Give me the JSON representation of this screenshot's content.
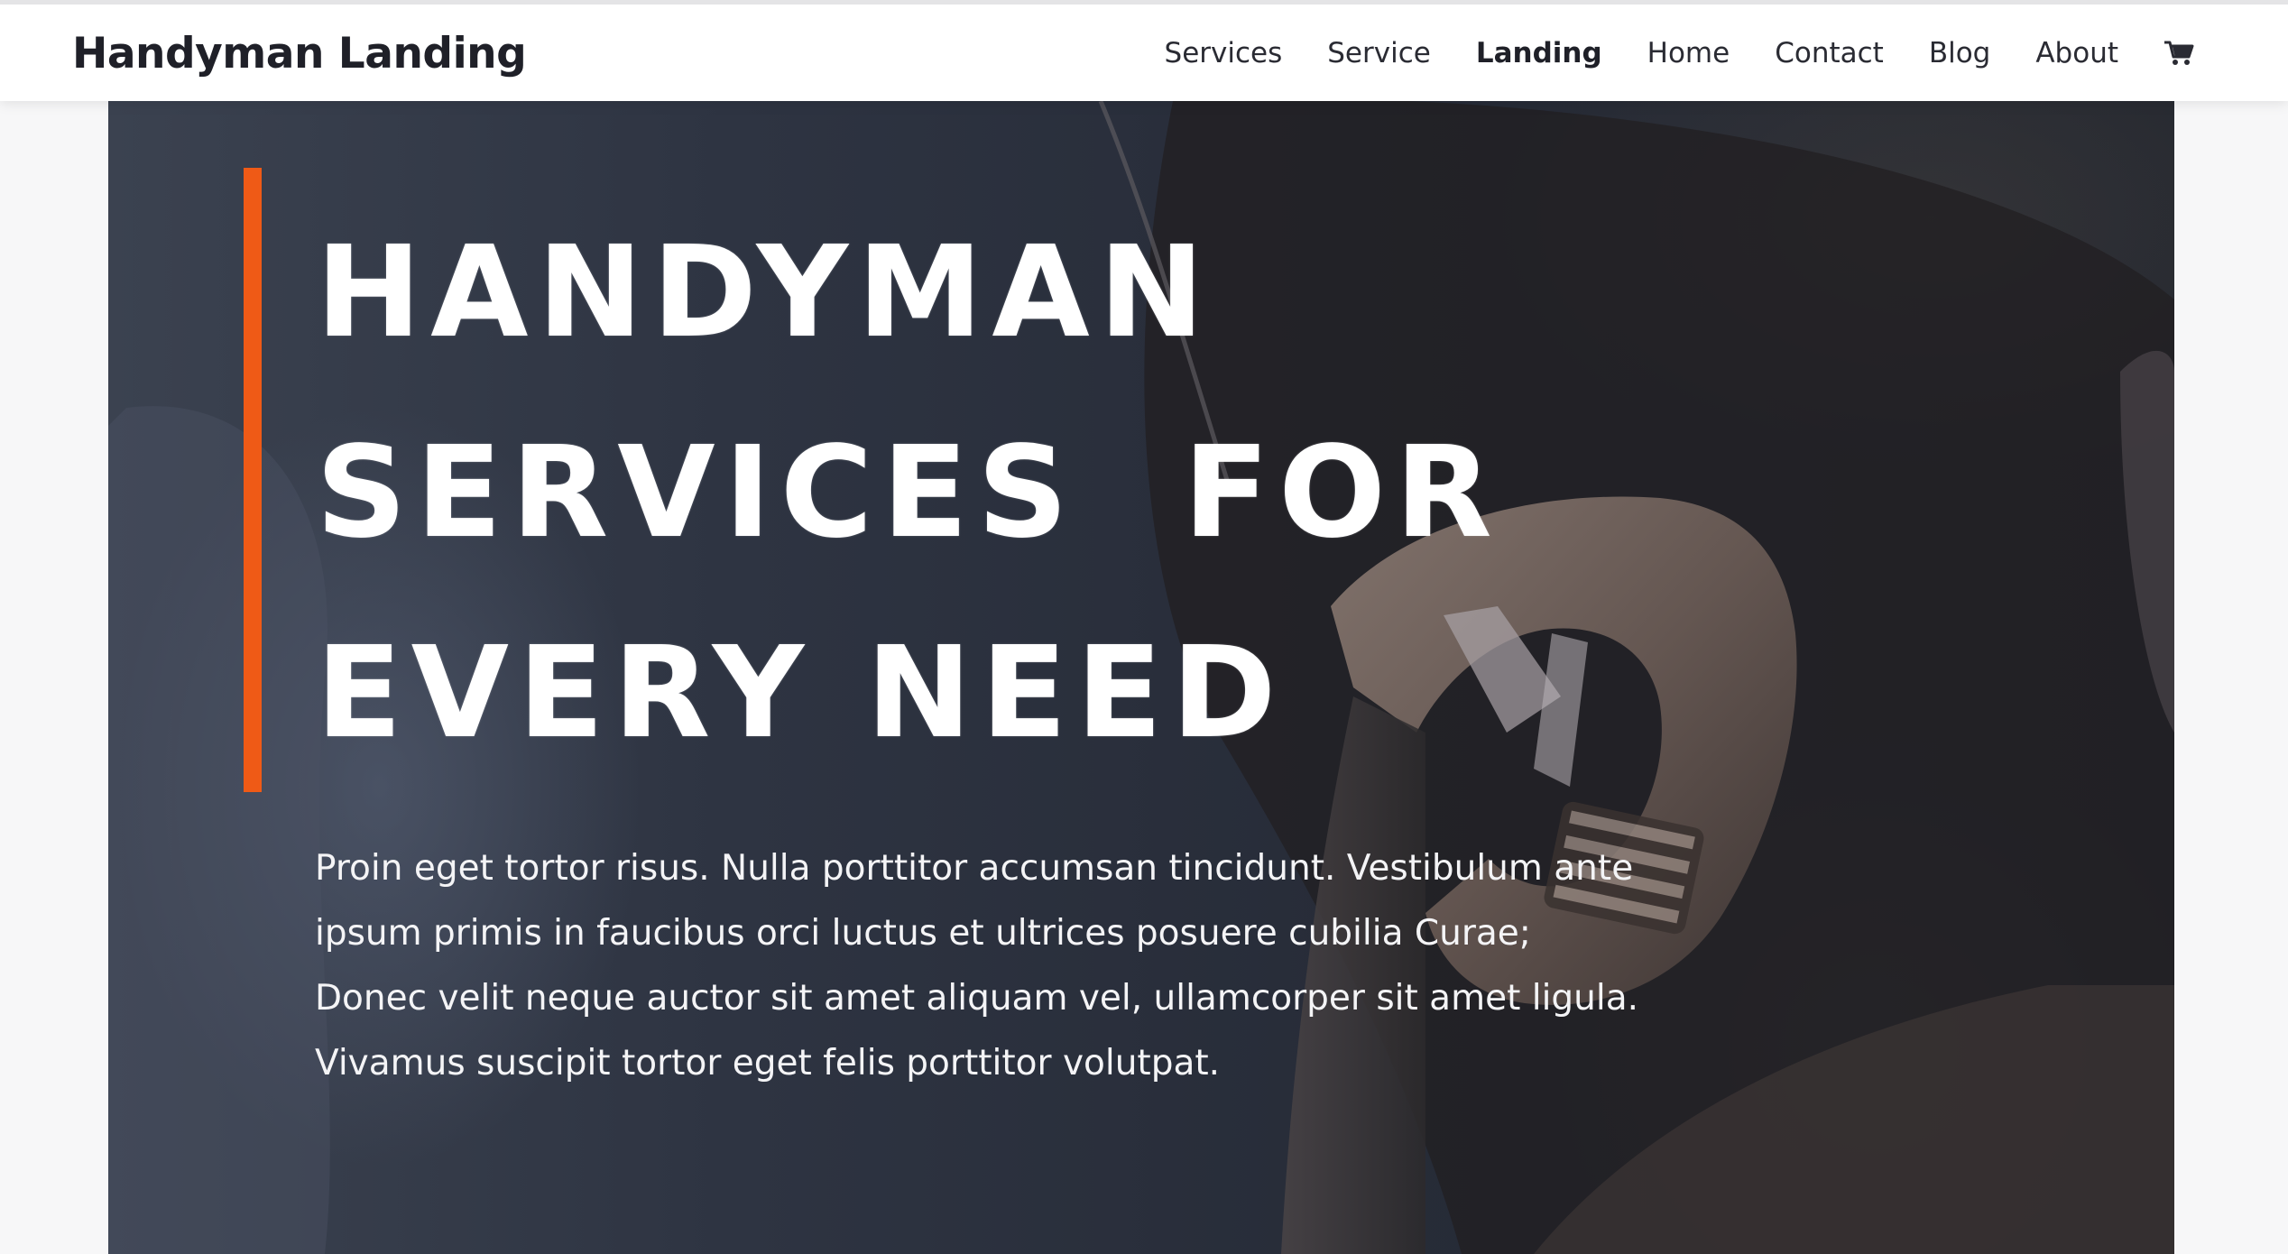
{
  "header": {
    "site_title": "Handyman Landing",
    "nav": [
      {
        "label": "Services"
      },
      {
        "label": "Service"
      },
      {
        "label": "Landing"
      },
      {
        "label": "Home"
      },
      {
        "label": "Contact"
      },
      {
        "label": "Blog"
      },
      {
        "label": "About"
      }
    ],
    "active_nav": "Landing",
    "cart_icon": "cart-icon"
  },
  "hero": {
    "title_lines": [
      "HANDYMAN",
      "SERVICES  FOR",
      "EVERY NEED"
    ],
    "body_lines": [
      "Proin eget tortor risus. Nulla porttitor accumsan tincidunt. Vestibulum ante",
      "ipsum primis in faucibus orci luctus et ultrices posuere cubilia Curae;",
      "Donec velit neque auctor sit amet aliquam vel, ullamcorper sit amet ligula.",
      "Vivamus suscipit tortor eget felis porttitor volutpat."
    ],
    "background_image": "wrench-photo"
  },
  "colors": {
    "accent": "#ef5a16",
    "hero_overlay": "#272c38",
    "header_bg": "#ffffff",
    "text_dark": "#1f2028"
  }
}
